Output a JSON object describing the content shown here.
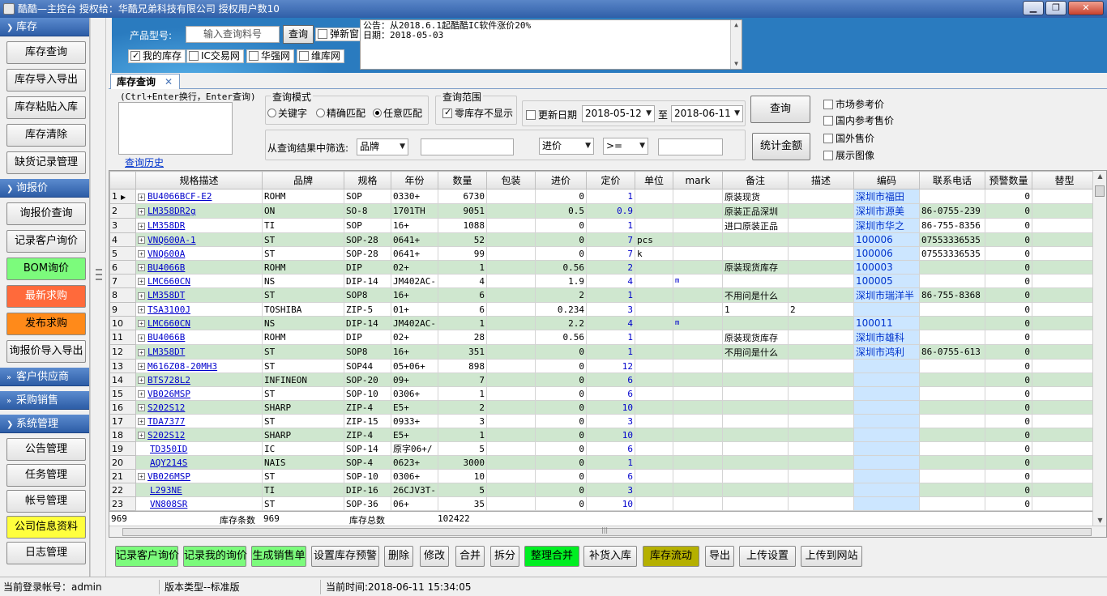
{
  "window": {
    "title": "酷酷—主控台 授权给：华酷兄弟科技有限公司 授权用户数10"
  },
  "sidebar": {
    "sections": [
      {
        "label": "库存",
        "items": [
          "库存查询",
          "库存导入导出",
          "库存粘贴入库",
          "库存清除",
          "缺货记录管理"
        ]
      },
      {
        "label": "询报价",
        "items": [
          "询报价查询",
          "记录客户询价",
          "BOM询价",
          "最新求购",
          "发布求购",
          "询报价导入导出"
        ]
      },
      {
        "label": "客户供应商",
        "items": []
      },
      {
        "label": "采购销售",
        "items": []
      },
      {
        "label": "系统管理",
        "items": [
          "公告管理",
          "任务管理",
          "帐号管理",
          "公司信息资料",
          "日志管理"
        ]
      }
    ]
  },
  "banner": {
    "product_label": "产品型号:",
    "search_placeholder": "输入查询料号",
    "search_button": "查询",
    "popup_label": "弹新窗",
    "checks": [
      "我的库存",
      "IC交易网",
      "华强网",
      "维库网"
    ],
    "notice_lines": [
      "公告：从2018.6.1起酷酷IC软件涨价20%",
      "日期：2018-05-03"
    ]
  },
  "tab": {
    "label": "库存查询"
  },
  "query": {
    "hint": "(Ctrl+Enter换行，Enter查询)",
    "history": "查询历史",
    "mode_legend": "查询模式",
    "modes": [
      "关键字",
      "精确匹配",
      "任意匹配"
    ],
    "range_legend": "查询范围",
    "zero_stock": "零库存不显示",
    "update_date": "更新日期",
    "date_from": "2018-05-12",
    "to": "至",
    "date_to": "2018-06-11",
    "query_button": "查询",
    "filter_label": "从查询结果中筛选:",
    "filter_field": "品牌",
    "price_field": "进价",
    "operator": ">=",
    "stat_button": "统计金额",
    "right_checks": [
      "市场参考价",
      "国内参考售价",
      "国外售价",
      "展示图像"
    ]
  },
  "grid": {
    "headers": [
      "规格描述",
      "品牌",
      "规格",
      "年份",
      "数量",
      "包装",
      "进价",
      "定价",
      "单位",
      "mark",
      "备注",
      "描述",
      "编码",
      "联系电话",
      "预警数量",
      "替型"
    ],
    "rows": [
      [
        "1",
        "BU4066BCF-E2",
        "ROHM",
        "SOP",
        "0330+",
        "6730",
        "",
        "0",
        "1",
        "",
        "",
        "原装现货",
        "",
        "深圳市福田",
        "",
        "0"
      ],
      [
        "2",
        "LM358DR2g",
        "ON",
        "SO-8",
        "1701TH",
        "9051",
        "",
        "0.5",
        "0.9",
        "",
        "",
        "原装正品深圳",
        "",
        "深圳市源美",
        "86-0755-239",
        "0"
      ],
      [
        "3",
        "LM358DR",
        "TI",
        "SOP",
        "16+",
        "1088",
        "",
        "0",
        "1",
        "",
        "",
        "进口原装正品",
        "",
        "深圳市华之",
        "86-755-8356",
        "0"
      ],
      [
        "4",
        "VNQ600A-1",
        "ST",
        "SOP-28",
        "0641+",
        "52",
        "",
        "0",
        "7",
        "pcs",
        "",
        "",
        "",
        "100006",
        "07553336535",
        "0"
      ],
      [
        "5",
        "VNQ600A",
        "ST",
        "SOP-28",
        "0641+",
        "99",
        "",
        "0",
        "7",
        "k",
        "",
        "",
        "",
        "100006",
        "07553336535",
        "0"
      ],
      [
        "6",
        "BU4066B",
        "ROHM",
        "DIP",
        "02+",
        "1",
        "",
        "0.56",
        "2",
        "",
        "",
        "原装现货库存",
        "",
        "100003",
        "",
        "0"
      ],
      [
        "7",
        "LMC660CN",
        "NS",
        "DIP-14",
        "JM402AC-",
        "4",
        "",
        "1.9",
        "4",
        "",
        "m",
        "",
        "",
        "100005",
        "",
        "0"
      ],
      [
        "8",
        "LM358DT",
        "ST",
        "SOP8",
        "16+",
        "6",
        "",
        "2",
        "1",
        "",
        "",
        "不用问是什么",
        "",
        "深圳市瑞洋半",
        "86-755-8368",
        "0"
      ],
      [
        "9",
        "TSA3100J",
        "TOSHIBA",
        "ZIP-5",
        "01+",
        "6",
        "",
        "0.234",
        "3",
        "",
        "",
        "1",
        "2",
        "",
        "",
        "0"
      ],
      [
        "10",
        "LMC660CN",
        "NS",
        "DIP-14",
        "JM402AC-",
        "1",
        "",
        "2.2",
        "4",
        "",
        "m",
        "",
        "",
        "100011",
        "",
        "0"
      ],
      [
        "11",
        "BU4066B",
        "ROHM",
        "DIP",
        "02+",
        "28",
        "",
        "0.56",
        "1",
        "",
        "",
        "原装现货库存",
        "",
        "深圳市雄科",
        "",
        "0"
      ],
      [
        "12",
        "LM358DT",
        "ST",
        "SOP8",
        "16+",
        "351",
        "",
        "0",
        "1",
        "",
        "",
        "不用问是什么",
        "",
        "深圳市鸿利",
        "86-0755-613",
        "0"
      ],
      [
        "13",
        "M616Z08-20MH3",
        "ST",
        "SOP44",
        "05+06+",
        "898",
        "",
        "0",
        "12",
        "",
        "",
        "",
        "",
        "",
        "",
        "0"
      ],
      [
        "14",
        "BTS728L2",
        "INFINEON",
        "SOP-20",
        "09+",
        "7",
        "",
        "0",
        "6",
        "",
        "",
        "",
        "",
        "",
        "",
        "0"
      ],
      [
        "15",
        "VB026MSP",
        "ST",
        "SOP-10",
        "0306+",
        "1",
        "",
        "0",
        "6",
        "",
        "",
        "",
        "",
        "",
        "",
        "0"
      ],
      [
        "16",
        "S202S12",
        "SHARP",
        "ZIP-4",
        "E5+",
        "2",
        "",
        "0",
        "10",
        "",
        "",
        "",
        "",
        "",
        "",
        "0"
      ],
      [
        "17",
        "TDA7377",
        "ST",
        "ZIP-15",
        "0933+",
        "3",
        "",
        "0",
        "3",
        "",
        "",
        "",
        "",
        "",
        "",
        "0"
      ],
      [
        "18",
        "S202S12",
        "SHARP",
        "ZIP-4",
        "E5+",
        "1",
        "",
        "0",
        "10",
        "",
        "",
        "",
        "",
        "",
        "",
        "0"
      ],
      [
        "19",
        "TD350ID",
        "IC",
        "SOP-14",
        "原字06+/",
        "5",
        "",
        "0",
        "6",
        "",
        "",
        "",
        "",
        "",
        "",
        "0"
      ],
      [
        "20",
        "AQY214S",
        "NAIS",
        "SOP-4",
        "0623+",
        "3000",
        "",
        "0",
        "1",
        "",
        "",
        "",
        "",
        "",
        "",
        "0"
      ],
      [
        "21",
        "VB026MSP",
        "ST",
        "SOP-10",
        "0306+",
        "10",
        "",
        "0",
        "6",
        "",
        "",
        "",
        "",
        "",
        "",
        "0"
      ],
      [
        "22",
        "L293NE",
        "TI",
        "DIP-16",
        "26CJV3T-",
        "5",
        "",
        "0",
        "3",
        "",
        "",
        "",
        "",
        "",
        "",
        "0"
      ],
      [
        "23",
        "VN808SR",
        "ST",
        "SOP-36",
        "06+",
        "35",
        "",
        "0",
        "10",
        "",
        "",
        "",
        "",
        "",
        "",
        "0"
      ]
    ],
    "footer": {
      "count_left": "969",
      "count_label": "库存条数",
      "count_value": "969",
      "total_label": "库存总数",
      "total_value": "102422"
    }
  },
  "toolbar": {
    "buttons": [
      "记录客户询价",
      "记录我的询价",
      "生成销售单",
      "设置库存预警",
      "删除",
      "修改",
      "合并",
      "拆分",
      "整理合并",
      "补货入库",
      "库存流动",
      "导出",
      "上传设置",
      "上传到网站"
    ]
  },
  "status": {
    "user": "当前登录帐号：admin",
    "version": "版本类型--标准版",
    "time": "当前时间:2018-06-11 15:34:05"
  }
}
